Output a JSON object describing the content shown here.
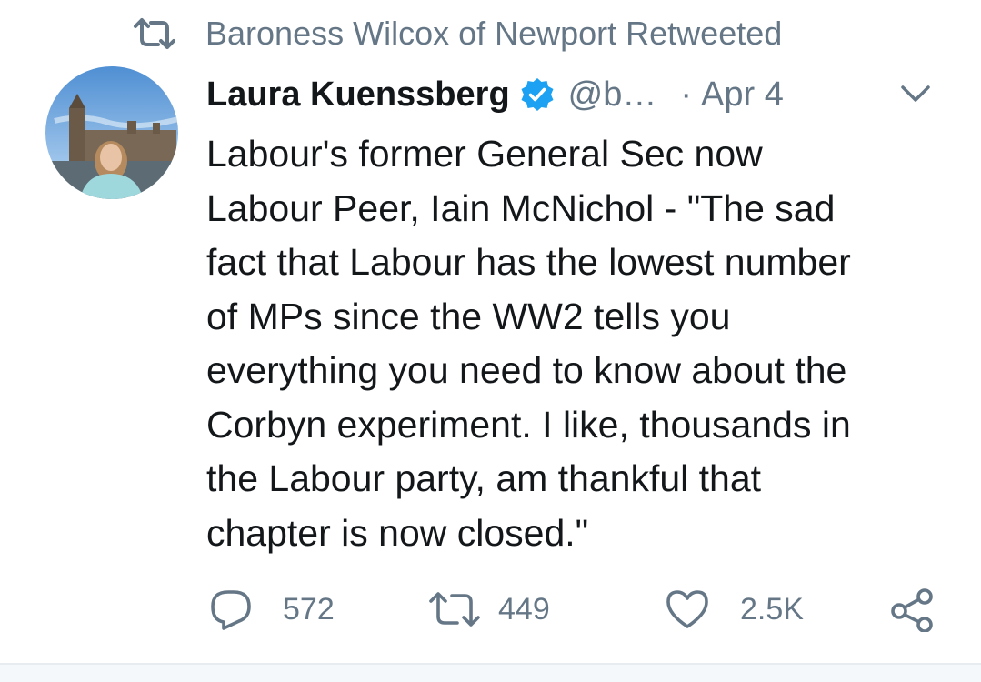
{
  "retweet_context": {
    "icon": "retweet-icon",
    "text": "Baroness Wilcox of Newport Retweeted"
  },
  "tweet": {
    "author": {
      "display_name": "Laura Kuenssberg",
      "verified": true,
      "handle": "@b…",
      "avatar_icon": "avatar-photo"
    },
    "separator": "·",
    "date": "Apr 4",
    "menu_icon": "chevron-down-icon",
    "text": "Labour's former General Sec now\nLabour Peer, Iain McNichol - \"The sad\nfact that Labour has the lowest number\nof MPs since the WW2 tells you\neverything you need to know about the\nCorbyn experiment. I like, thousands in\nthe Labour party, am thankful that\nchapter is now closed.\"",
    "actions": {
      "reply_count": "572",
      "retweet_count": "449",
      "like_count": "2.5K",
      "share_icon": "share-icon"
    }
  },
  "colors": {
    "text_primary": "#14171a",
    "text_secondary": "#657786",
    "verified_blue": "#1da1f2",
    "divider": "#e6ecf0"
  }
}
